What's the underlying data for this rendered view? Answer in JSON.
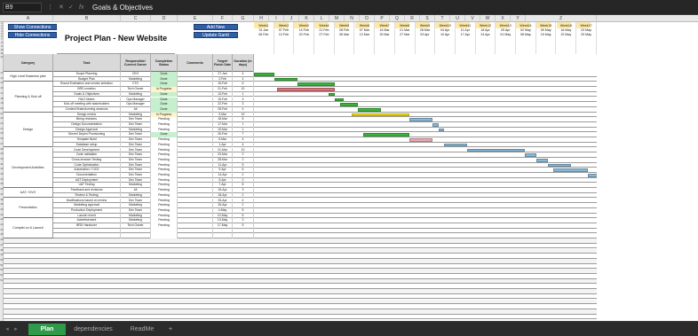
{
  "formula_bar": {
    "cell_ref": "B9",
    "content": "Goals & Objectives"
  },
  "columns": [
    "A",
    "B",
    "C",
    "D",
    "E",
    "F",
    "G",
    "H",
    "I",
    "J",
    "K",
    "L",
    "M",
    "N",
    "O",
    "P",
    "Q",
    "R",
    "S",
    "T",
    "U",
    "V",
    "W",
    "X",
    "Y",
    "Z"
  ],
  "buttons": {
    "show": "Show Connections",
    "hide": "Hide Connections",
    "add": "Add New Dependency",
    "update": "Update Gantt"
  },
  "title": "Project Plan - New Website",
  "headers": {
    "category": "Category",
    "task": "Task",
    "owner": "Responsible/ Current Owner",
    "status": "Completion Status",
    "comments": "Comments",
    "target": "Target/ Finish Date",
    "duration": "Duration (in days)"
  },
  "weeks": [
    {
      "w": "Week1",
      "s": "31 Jan",
      "e": "06 Feb"
    },
    {
      "w": "Week2",
      "s": "07 Feb",
      "e": "13 Feb"
    },
    {
      "w": "Week3",
      "s": "14 Feb",
      "e": "20 Feb"
    },
    {
      "w": "Week4",
      "s": "21 Feb",
      "e": "27 Feb"
    },
    {
      "w": "Week5",
      "s": "28 Feb",
      "e": "06 Mar"
    },
    {
      "w": "Week6",
      "s": "07 Mar",
      "e": "13 Mar"
    },
    {
      "w": "Week7",
      "s": "14 Mar",
      "e": "20 Mar"
    },
    {
      "w": "Week8",
      "s": "21 Mar",
      "e": "27 Mar"
    },
    {
      "w": "Week9",
      "s": "28 Mar",
      "e": "03 Apr"
    },
    {
      "w": "Week10",
      "s": "04 Apr",
      "e": "10 Apr"
    },
    {
      "w": "Week11",
      "s": "11 Apr",
      "e": "17 Apr"
    },
    {
      "w": "Week12",
      "s": "18 Apr",
      "e": "24 Apr"
    },
    {
      "w": "Week13",
      "s": "25 Apr",
      "e": "01 May"
    },
    {
      "w": "Week14",
      "s": "02 May",
      "e": "08 May"
    },
    {
      "w": "Week15",
      "s": "09 May",
      "e": "15 May"
    },
    {
      "w": "Week16",
      "s": "16 May",
      "e": "22 May"
    },
    {
      "w": "Week17",
      "s": "23 May",
      "e": "29 May"
    }
  ],
  "categories": [
    {
      "name": "High Level Business plan",
      "rows": [
        0,
        1
      ]
    },
    {
      "name": "Planning & Kick off",
      "rows": [
        2,
        7
      ]
    },
    {
      "name": "Design",
      "rows": [
        8,
        14
      ]
    },
    {
      "name": "Development Activities",
      "rows": [
        15,
        22
      ]
    },
    {
      "name": "UAT / DVO",
      "rows": [
        23,
        24
      ]
    },
    {
      "name": "Presentation",
      "rows": [
        25,
        28
      ]
    },
    {
      "name": "Complet on & Launch",
      "rows": [
        29,
        32
      ]
    }
  ],
  "tasks": [
    {
      "task": "Scope Planning",
      "owner": "CEO",
      "status": "Done",
      "date": "27-Jan",
      "dur": "4",
      "bar": [
        0,
        3.5
      ],
      "color": "#3cb43c"
    },
    {
      "task": "Budget Plan",
      "owner": "Marketing",
      "status": "Done",
      "date": "2-Feb",
      "dur": "4",
      "bar": [
        3.5,
        7.5
      ],
      "color": "#3cb43c"
    },
    {
      "task": "Round Estimation and vendor selection",
      "owner": "CTO",
      "status": "Done",
      "date": "15-Feb",
      "dur": "6",
      "bar": [
        7.5,
        14
      ],
      "color": "#3cb43c"
    },
    {
      "task": "BRD creation",
      "owner": "Tech Owner",
      "status": "In Progress",
      "date": "21-Feb",
      "dur": "10",
      "bar": [
        4,
        14
      ],
      "color": "#d9727a"
    },
    {
      "task": "Goals & Objectives",
      "owner": "Marketing",
      "status": "Done",
      "date": "13-Feb",
      "dur": "1",
      "bar": [
        13,
        14
      ],
      "color": "#3cb43c"
    },
    {
      "task": "RACI Matrix",
      "owner": "Ops Manager",
      "status": "Done",
      "date": "15-Feb",
      "dur": "3",
      "bar": [
        14,
        15.5
      ],
      "color": "#3cb43c"
    },
    {
      "task": "Kick off meeting with stakeholders",
      "owner": "Ops Manager",
      "status": "Done",
      "date": "22-Feb",
      "dur": "3",
      "bar": [
        15,
        18
      ],
      "color": "#3cb43c"
    },
    {
      "task": "Content Brainstorming sessions",
      "owner": "All",
      "status": "Done",
      "date": "28-Feb",
      "dur": "4",
      "bar": [
        18,
        22
      ],
      "color": "#3cb43c"
    },
    {
      "task": "Design review",
      "owner": "Marketing",
      "status": "In Progress",
      "date": "3-Mar",
      "dur": "10",
      "bar": [
        17,
        27
      ],
      "color": "#f0e010"
    },
    {
      "task": "Being revisions",
      "owner": "Dev Team",
      "status": "Pending",
      "date": "18-Mar",
      "dur": "5",
      "bar": [
        27,
        31
      ],
      "color": "#8ab8d8"
    },
    {
      "task": "Design Documentation",
      "owner": "Dev Team",
      "status": "Pending",
      "date": "17-Mar",
      "dur": "1",
      "bar": [
        31,
        32
      ],
      "color": "#8ab8d8"
    },
    {
      "task": "Design Approval",
      "owner": "Marketing",
      "status": "Pending",
      "date": "19-Mar",
      "dur": "1",
      "bar": [
        32,
        33
      ],
      "color": "#8ab8d8"
    },
    {
      "task": "Server/ Depen Provisioning",
      "owner": "Dev Team",
      "status": "Done",
      "date": "26-Feb",
      "dur": "7",
      "bar": [
        19,
        27
      ],
      "color": "#3cb43c"
    },
    {
      "task": "Template Build",
      "owner": "Dev Team",
      "status": "Pending",
      "date": "5-Mar",
      "dur": "4",
      "bar": [
        27,
        31
      ],
      "color": "#e9a9b3"
    },
    {
      "task": "Database setup",
      "owner": "Dev Team",
      "status": "Pending",
      "date": "1-Apr",
      "dur": "4",
      "bar": [
        33,
        37
      ],
      "color": "#8ab8d8"
    },
    {
      "task": "Code Development",
      "owner": "Dev Team",
      "status": "Pending",
      "date": "21-Mar",
      "dur": "10",
      "bar": [
        37,
        47
      ],
      "color": "#8ab8d8"
    },
    {
      "task": "Code validation",
      "owner": "Dev Team",
      "status": "Pending",
      "date": "23-Mar",
      "dur": "2",
      "bar": [
        47,
        49
      ],
      "color": "#8ab8d8"
    },
    {
      "task": "Cross-browser Testing",
      "owner": "Dev Team",
      "status": "Pending",
      "date": "28-Mar",
      "dur": "2",
      "bar": [
        49,
        51
      ],
      "color": "#8ab8d8"
    },
    {
      "task": "Code Optimization",
      "owner": "Dev Team",
      "status": "Pending",
      "date": "11-Apr",
      "dur": "5",
      "bar": [
        51,
        55
      ],
      "color": "#8ab8d8"
    },
    {
      "task": "Automation / CICD",
      "owner": "Dev Team",
      "status": "Pending",
      "date": "9-Apr",
      "dur": "6",
      "bar": [
        52,
        58
      ],
      "color": "#8ab8d8"
    },
    {
      "task": "Documentation",
      "owner": "Dev Team",
      "status": "Pending",
      "date": "14-Apr",
      "dur": "2",
      "bar": [
        58,
        60
      ],
      "color": "#8ab8d8"
    },
    {
      "task": "UAT Deployment",
      "owner": "Dev Team",
      "status": "Pending",
      "date": "5-Apr",
      "dur": "2",
      "bar": [
        60,
        62
      ],
      "color": "#8ab8d8"
    },
    {
      "task": "UAT Testing",
      "owner": "Marketing",
      "status": "Pending",
      "date": "7-Apr",
      "dur": "8",
      "bar": [
        62,
        70
      ],
      "color": "#8ab8d8"
    },
    {
      "task": "Feedback and revisions",
      "owner": "All",
      "status": "Pending",
      "date": "15-Apr",
      "dur": "3",
      "bar": [
        70,
        73
      ],
      "color": "#8ab8d8"
    },
    {
      "task": "Review & Testing",
      "owner": "Marketing",
      "status": "Pending",
      "date": "18-Apr",
      "dur": "2",
      "bar": [
        73,
        75
      ],
      "color": "#8ab8d8"
    },
    {
      "task": "Modifications based on review",
      "owner": "Dev Team",
      "status": "Pending",
      "date": "25-Apr",
      "dur": "4",
      "bar": [
        75,
        79
      ],
      "color": "#8ab8d8"
    },
    {
      "task": "Marketing approval",
      "owner": "Marketing",
      "status": "Pending",
      "date": "26-Apr",
      "dur": "2",
      "bar": [
        79,
        81
      ],
      "color": "#8ab8d8"
    },
    {
      "task": "Production Deployment",
      "owner": "Dev Team",
      "status": "Pending",
      "date": "4-May",
      "dur": "5",
      "bar": [
        81,
        86
      ],
      "color": "#8ab8d8"
    },
    {
      "task": "Launch event",
      "owner": "Marketing",
      "status": "Pending",
      "date": "10-May",
      "dur": "5",
      "bar": [
        86,
        91
      ],
      "color": "#8ab8d8"
    },
    {
      "task": "Advertisement",
      "owner": "Marketing",
      "status": "Pending",
      "date": "13-May",
      "dur": "3",
      "bar": [
        91,
        94
      ],
      "color": "#8ab8d8"
    },
    {
      "task": "BRD Handover",
      "owner": "Tech Owner",
      "status": "Pending",
      "date": "17-May",
      "dur": "5",
      "bar": [
        94,
        99
      ],
      "color": "#8ab8d8"
    },
    {
      "task": "",
      "owner": "",
      "status": "",
      "date": "",
      "dur": "",
      "bar": null,
      "color": ""
    },
    {
      "task": "",
      "owner": "",
      "status": "",
      "date": "",
      "dur": "",
      "bar": null,
      "color": ""
    }
  ],
  "row_numbers": [
    "1",
    "2",
    "3",
    "4",
    "5",
    "6",
    "7",
    "8",
    "9",
    "10",
    "11",
    "12",
    "13",
    "14",
    "15",
    "16",
    "17",
    "18",
    "19",
    "20",
    "21",
    "22",
    "23",
    "24",
    "25",
    "26",
    "27",
    "28",
    "29",
    "30",
    "31",
    "32",
    "33",
    "34",
    "35",
    "36",
    "37",
    "38",
    "39",
    "40",
    "41",
    "42",
    "43",
    "44",
    "45",
    "46",
    "47",
    "48",
    "49",
    "50",
    "51",
    "52",
    "53",
    "54"
  ],
  "tabs": [
    {
      "label": "Plan",
      "active": true
    },
    {
      "label": "dependencies",
      "active": false
    },
    {
      "label": "ReadMe",
      "active": false
    }
  ],
  "add_tab": "+",
  "colors": {
    "done": "#3cb43c",
    "in_progress": "#d9727a",
    "review": "#f0e010",
    "pending": "#8ab8d8",
    "button": "#2f5fa5",
    "tab_active": "#2e9a4a"
  }
}
